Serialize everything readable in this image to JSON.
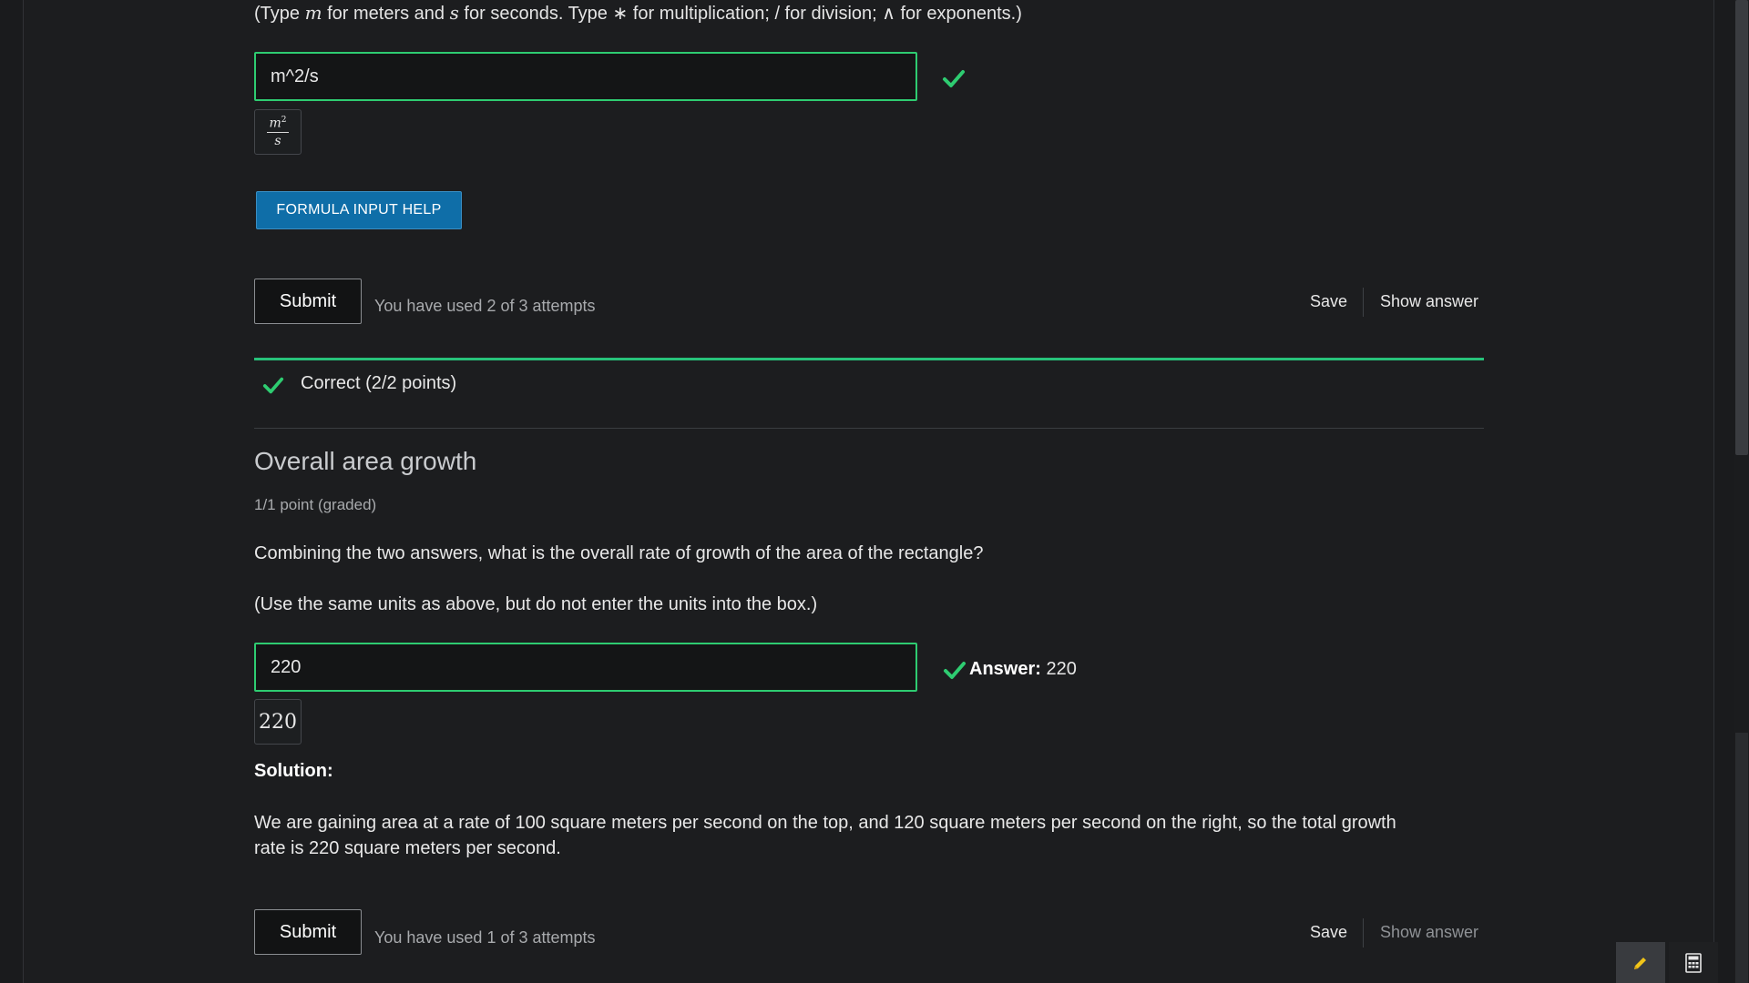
{
  "q1": {
    "hint_prefix": "(Type ",
    "hint_m": "m",
    "hint_mid1": " for meters and ",
    "hint_s": "s",
    "hint_mid2": " for seconds. Type ",
    "hint_star": "∗",
    "hint_mid3": " for multiplication; / for division; ",
    "hint_caret": "∧",
    "hint_suffix": " for exponents.)",
    "input_value": "m^2/s",
    "preview_num": "m",
    "preview_sup": "2",
    "preview_den": "s",
    "help_label": "FORMULA INPUT HELP",
    "submit_label": "Submit",
    "attempts": "You have used 2 of 3 attempts",
    "save_label": "Save",
    "show_answer_label": "Show answer",
    "status": "Correct (2/2 points)"
  },
  "q2": {
    "title": "Overall area growth",
    "points": "1/1 point (graded)",
    "prompt": "Combining the two answers, what is the overall rate of growth of the area of the rectangle?",
    "note": "(Use the same units as above, but do not enter the units into the box.)",
    "input_value": "220",
    "answer_label": "Answer:",
    "answer_value": "220",
    "preview": "220",
    "solution_heading": "Solution:",
    "solution_line1": "We are gaining area at a rate of 100 square meters per second on the top, and 120 square meters per second on the right, so the total growth",
    "solution_line2": "rate is 220 square meters per second.",
    "submit_label": "Submit",
    "attempts": "You have used 1 of 3 attempts",
    "save_label": "Save",
    "show_answer_label": "Show answer"
  },
  "colors": {
    "correct": "#2ecc71",
    "accent_button": "#0f6ea8"
  },
  "icons": {
    "check": "checkmark-icon",
    "pencil": "pencil-icon",
    "calculator": "calculator-icon"
  }
}
